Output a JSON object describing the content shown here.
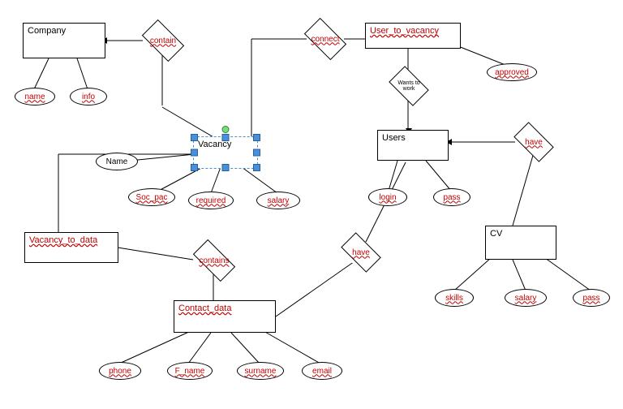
{
  "entities": {
    "company": "Company",
    "vacancy": "Vacancy",
    "vacancy_to_data": "Vacancy_to_data",
    "contact_data": "Contact_data",
    "user_to_vacancy": "User_to_vacancy",
    "users": "Users",
    "cv": "CV"
  },
  "relationships": {
    "contain": "contain",
    "contains": "contains",
    "connect": "connect",
    "wants_to_work": "Wants to work",
    "have_users": "have",
    "have_contact": "have"
  },
  "attributes": {
    "company_name": "name",
    "company_info": "info",
    "vacancy_name": "Name",
    "vacancy_soc_pac": "Soc_pac",
    "vacancy_required": "required",
    "vacancy_salary": "salary",
    "user_to_vacancy_approved": "approved",
    "users_login": "login",
    "users_pass": "pass",
    "cv_skills": "skills",
    "cv_salary": "salary",
    "cv_pass": "pass",
    "contact_phone": "phone",
    "contact_fname": "F_name",
    "contact_surname": "surname",
    "contact_email": "email"
  }
}
